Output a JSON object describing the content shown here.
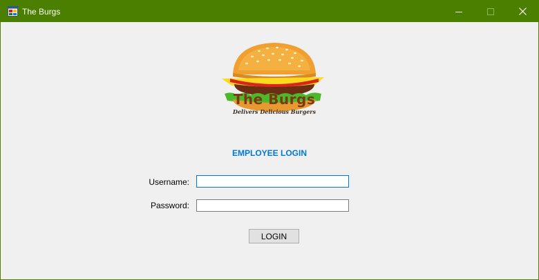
{
  "window": {
    "title": "The Burgs",
    "title_bar_color": "#4a7f00",
    "controls": [
      "minimize-icon",
      "maximize-icon",
      "close-icon"
    ]
  },
  "logo": {
    "title": "The Burgs",
    "tagline": "Delivers Delicious Burgers",
    "image": "hamburger-icon"
  },
  "form": {
    "heading": "EMPLOYEE LOGIN",
    "heading_color": "#0078d7",
    "username_label": "Username:",
    "username_value": "",
    "password_label": "Password:",
    "password_value": "",
    "login_label": "LOGIN"
  }
}
